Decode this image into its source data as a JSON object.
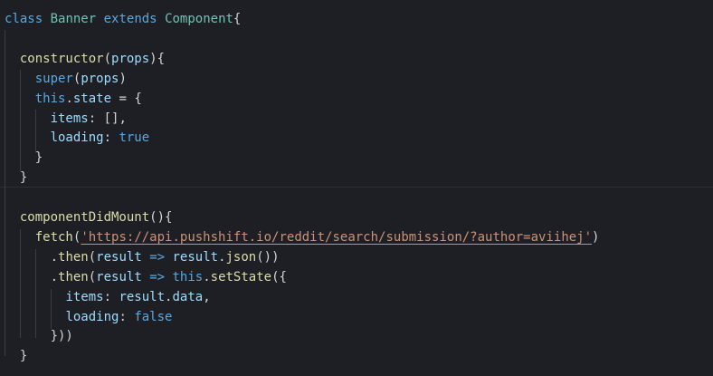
{
  "theme": {
    "background": "#1e1f24",
    "keyword": "#5aa8e0",
    "class_name": "#6cc4b4",
    "function": "#dcdcaa",
    "property": "#9cdcfe",
    "string": "#ce9178",
    "plain": "#d4d4d4"
  },
  "code": {
    "lines": [
      [
        {
          "t": "class",
          "c": "keyword"
        },
        {
          "t": " "
        },
        {
          "t": "Banner",
          "c": "class_name"
        },
        {
          "t": " "
        },
        {
          "t": "extends",
          "c": "keyword"
        },
        {
          "t": " "
        },
        {
          "t": "Component",
          "c": "class_name"
        },
        {
          "t": "{"
        }
      ],
      [],
      [
        {
          "t": "  "
        },
        {
          "t": "constructor",
          "c": "function"
        },
        {
          "t": "("
        },
        {
          "t": "props",
          "c": "property"
        },
        {
          "t": "){"
        }
      ],
      [
        {
          "t": "    "
        },
        {
          "t": "super",
          "c": "keyword"
        },
        {
          "t": "("
        },
        {
          "t": "props",
          "c": "property"
        },
        {
          "t": ")"
        }
      ],
      [
        {
          "t": "    "
        },
        {
          "t": "this",
          "c": "keyword"
        },
        {
          "t": "."
        },
        {
          "t": "state",
          "c": "property"
        },
        {
          "t": " = {"
        }
      ],
      [
        {
          "t": "      "
        },
        {
          "t": "items",
          "c": "property"
        },
        {
          "t": ": [],"
        }
      ],
      [
        {
          "t": "      "
        },
        {
          "t": "loading",
          "c": "property"
        },
        {
          "t": ": "
        },
        {
          "t": "true",
          "c": "keyword"
        }
      ],
      [
        {
          "t": "    }"
        }
      ],
      [
        {
          "t": "  }"
        }
      ],
      [],
      [
        {
          "t": "  "
        },
        {
          "t": "componentDidMount",
          "c": "function"
        },
        {
          "t": "(){"
        }
      ],
      [
        {
          "t": "    "
        },
        {
          "t": "fetch",
          "c": "function"
        },
        {
          "t": "("
        },
        {
          "t": "'https://api.pushshift.io/reddit/search/submission/?author=aviihej'",
          "c": "string",
          "u": true
        },
        {
          "t": ")"
        }
      ],
      [
        {
          "t": "      ."
        },
        {
          "t": "then",
          "c": "function"
        },
        {
          "t": "("
        },
        {
          "t": "result",
          "c": "property"
        },
        {
          "t": " "
        },
        {
          "t": "=>",
          "c": "keyword"
        },
        {
          "t": " "
        },
        {
          "t": "result",
          "c": "property"
        },
        {
          "t": "."
        },
        {
          "t": "json",
          "c": "function"
        },
        {
          "t": "())"
        }
      ],
      [
        {
          "t": "      ."
        },
        {
          "t": "then",
          "c": "function"
        },
        {
          "t": "("
        },
        {
          "t": "result",
          "c": "property"
        },
        {
          "t": " "
        },
        {
          "t": "=>",
          "c": "keyword"
        },
        {
          "t": " "
        },
        {
          "t": "this",
          "c": "keyword"
        },
        {
          "t": "."
        },
        {
          "t": "setState",
          "c": "function"
        },
        {
          "t": "({"
        }
      ],
      [
        {
          "t": "        "
        },
        {
          "t": "items",
          "c": "property"
        },
        {
          "t": ": "
        },
        {
          "t": "result",
          "c": "property"
        },
        {
          "t": "."
        },
        {
          "t": "data",
          "c": "property"
        },
        {
          "t": ","
        }
      ],
      [
        {
          "t": "        "
        },
        {
          "t": "loading",
          "c": "property"
        },
        {
          "t": ": "
        },
        {
          "t": "false",
          "c": "keyword"
        }
      ],
      [
        {
          "t": "      }))"
        }
      ],
      [
        {
          "t": "  }"
        }
      ]
    ]
  }
}
